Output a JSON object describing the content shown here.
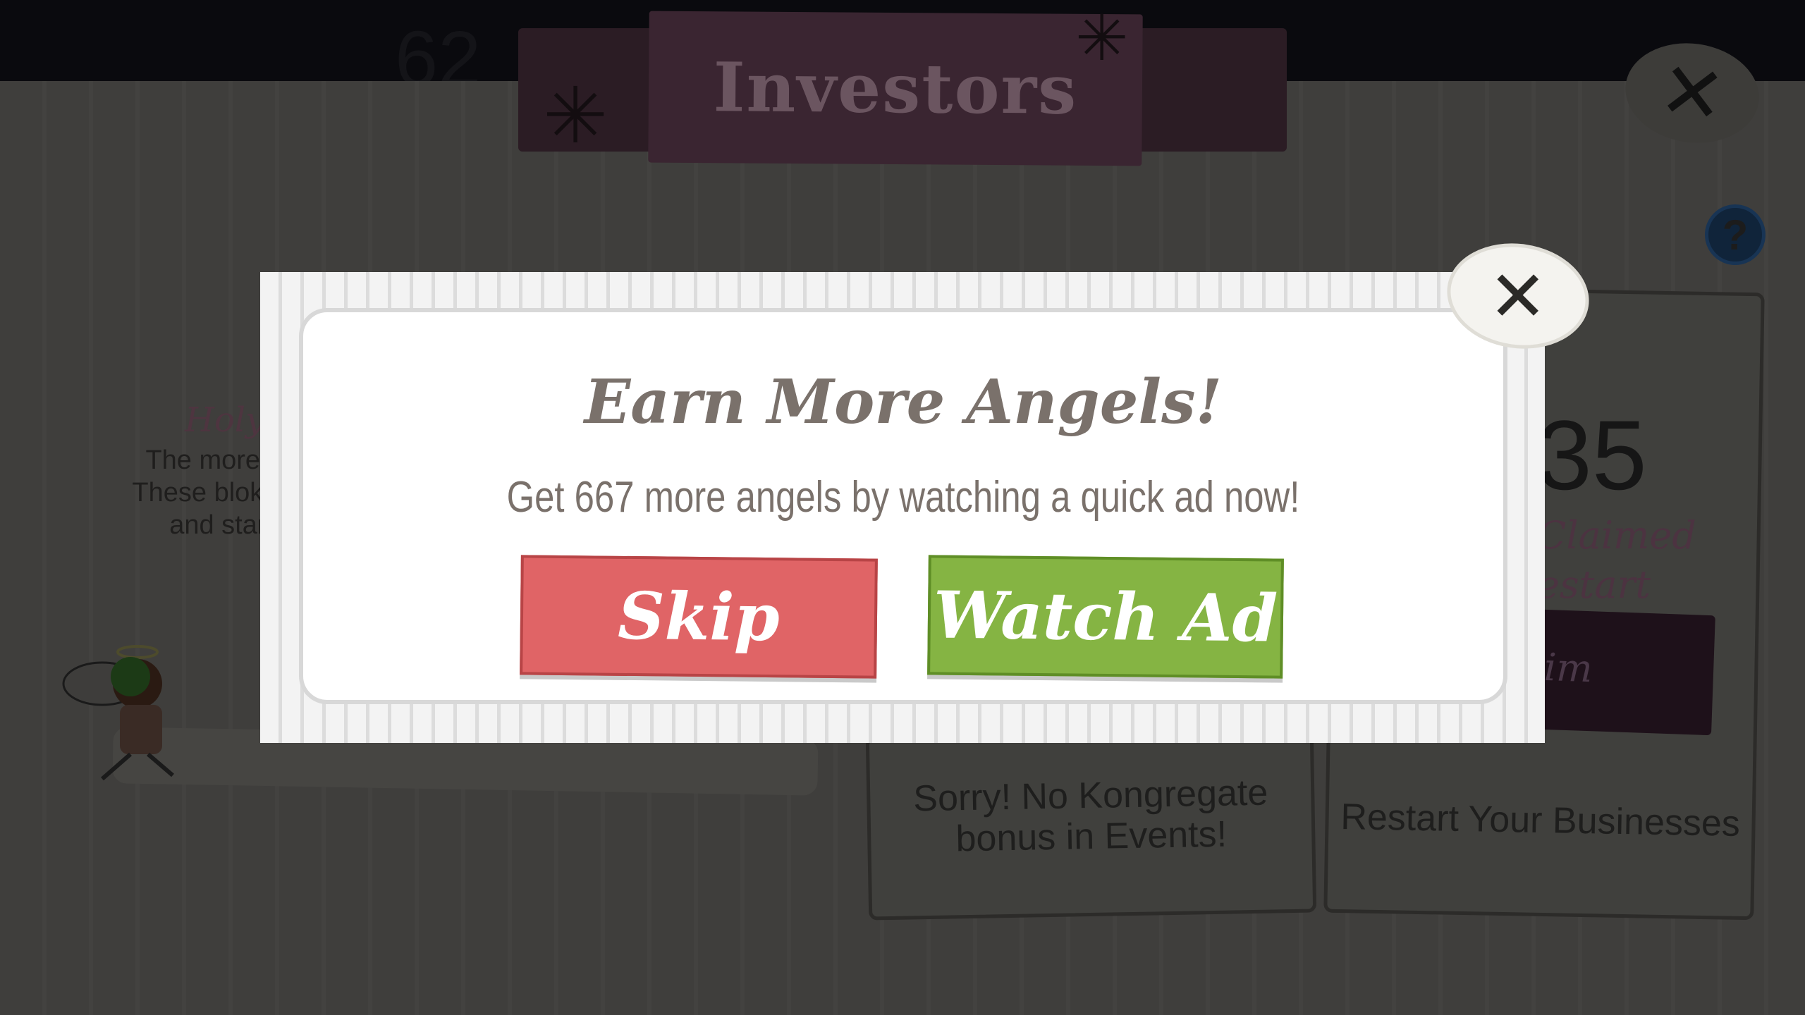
{
  "background": {
    "header_number": "62",
    "title": "Investors",
    "close_icon": "x-close-icon",
    "help_icon": "?",
    "holy_title": "Holy",
    "holy_lines": [
      "The more mon",
      "These blokes inc",
      "and start o"
    ],
    "kongregate_card_text": "Sorry! No Kongregate bonus in Events!",
    "restart_number": "35",
    "restart_claimed": "Claimed",
    "restart_restart": "estart",
    "claim_button_label": "im",
    "restart_card_text": "Restart Your Businesses"
  },
  "modal": {
    "title": "Earn More Angels!",
    "message": "Get 667 more angels by watching a quick ad now!",
    "skip_label": "Skip",
    "watch_label": "Watch Ad",
    "close_icon": "x-close-icon",
    "colors": {
      "skip": "#e06466",
      "watch": "#85b443",
      "text": "#7a716b"
    }
  }
}
